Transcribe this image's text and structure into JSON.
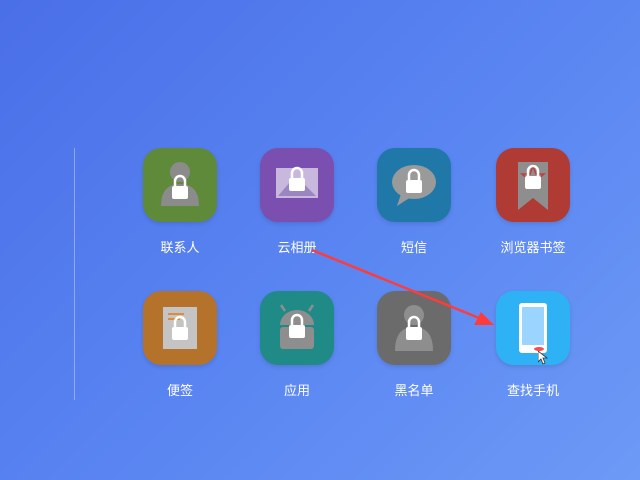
{
  "apps": [
    {
      "label": "联系人",
      "icon": "contacts-icon",
      "color": "#5f8a3a"
    },
    {
      "label": "云相册",
      "icon": "cloud-album-icon",
      "color": "#7a4fb0"
    },
    {
      "label": "短信",
      "icon": "sms-icon",
      "color": "#1f78a8"
    },
    {
      "label": "浏览器书签",
      "icon": "bookmark-icon",
      "color": "#b03a34"
    },
    {
      "label": "便签",
      "icon": "notes-icon",
      "color": "#b5722a"
    },
    {
      "label": "应用",
      "icon": "android-icon",
      "color": "#1f8a86"
    },
    {
      "label": "黑名单",
      "icon": "blacklist-icon",
      "color": "#6b6b6b"
    },
    {
      "label": "查找手机",
      "icon": "find-phone-icon",
      "color": "#2fb2f5"
    }
  ],
  "colors": {
    "background_start": "#4a6fe8",
    "background_end": "#6d9af6",
    "arrow": "#ff3b3b"
  }
}
